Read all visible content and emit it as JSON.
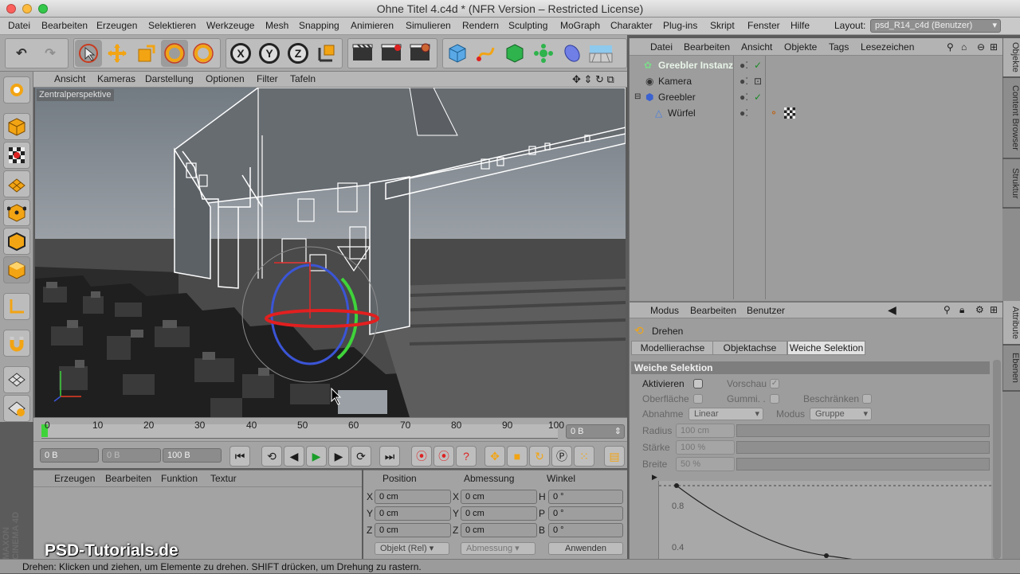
{
  "window": {
    "title": "Ohne Titel 4.c4d * (NFR Version – Restricted License)"
  },
  "menu": [
    "Datei",
    "Bearbeiten",
    "Erzeugen",
    "Selektieren",
    "Werkzeuge",
    "Mesh",
    "Snapping",
    "Animieren",
    "Simulieren",
    "Rendern",
    "Sculpting",
    "MoGraph",
    "Charakter",
    "Plug-ins",
    "Skript",
    "Fenster",
    "Hilfe"
  ],
  "layout": {
    "label": "Layout:",
    "value": "psd_R14_c4d (Benutzer)"
  },
  "toolbar": {
    "axis_x": "X",
    "axis_y": "Y",
    "axis_z": "Z"
  },
  "viewport": {
    "menu": [
      "Ansicht",
      "Kameras",
      "Darstellung",
      "Optionen",
      "Filter",
      "Tafeln"
    ],
    "label": "Zentralperspektive"
  },
  "timeline": {
    "ticks": [
      "0",
      "10",
      "20",
      "30",
      "40",
      "50",
      "60",
      "70",
      "80",
      "90",
      "100"
    ],
    "frame_field": "0 B",
    "playhead_fraction": 0.0
  },
  "transport": {
    "start": "0 B",
    "current": "0 B",
    "end": "100 B"
  },
  "material": {
    "menu": [
      "Erzeugen",
      "Bearbeiten",
      "Funktion",
      "Textur"
    ]
  },
  "coords": {
    "headers": [
      "Position",
      "Abmessung",
      "Winkel"
    ],
    "rows": [
      {
        "a": "X",
        "pos": "0 cm",
        "b": "X",
        "size": "0 cm",
        "c": "H",
        "rot": "0 °"
      },
      {
        "a": "Y",
        "pos": "0 cm",
        "b": "Y",
        "size": "0 cm",
        "c": "P",
        "rot": "0 °"
      },
      {
        "a": "Z",
        "pos": "0 cm",
        "b": "Z",
        "size": "0 cm",
        "c": "B",
        "rot": "0 °"
      }
    ],
    "mode": "Objekt (Rel)",
    "size_mode": "Abmessung",
    "apply": "Anwenden"
  },
  "objects": {
    "menu": [
      "Datei",
      "Bearbeiten",
      "Ansicht",
      "Objekte",
      "Tags",
      "Lesezeichen"
    ],
    "items": [
      {
        "name": "Greebler Instanz",
        "color": "#e8f5e8"
      },
      {
        "name": "Kamera",
        "color": "#111111"
      },
      {
        "name": "Greebler",
        "color": "#111111"
      },
      {
        "name": "Würfel",
        "color": "#111111"
      }
    ],
    "side_tabs": [
      "Objekte",
      "Content Browser",
      "Struktur"
    ]
  },
  "attributes": {
    "menu": [
      "Modus",
      "Bearbeiten",
      "Benutzer"
    ],
    "tool": "Drehen",
    "tabs": [
      "Modellierachse",
      "Objektachse",
      "Weiche Selektion"
    ],
    "active_tab": 2,
    "section": "Weiche Selektion",
    "aktivieren": "Aktivieren",
    "vorschau": "Vorschau",
    "oberflaeche": "Oberfläche",
    "gummi": "Gummi. .",
    "beschraenken": "Beschränken",
    "abnahme_label": "Abnahme",
    "abnahme_value": "Linear",
    "modus_label": "Modus",
    "modus_value": "Gruppe",
    "radius_label": "Radius",
    "radius_value": "100 cm",
    "staerke_label": "Stärke",
    "staerke_value": "100 %",
    "breite_label": "Breite",
    "breite_value": "50 %",
    "graph_labels": [
      "0.8",
      "0.4"
    ],
    "side_tabs": [
      "Attribute",
      "Ebenen"
    ]
  },
  "watermark": {
    "brand": "MAXON CINEMA 4D",
    "site": "PSD-Tutorials.de"
  },
  "status": "Drehen: Klicken und ziehen, um Elemente zu drehen. SHIFT drücken, um Drehung zu rastern."
}
